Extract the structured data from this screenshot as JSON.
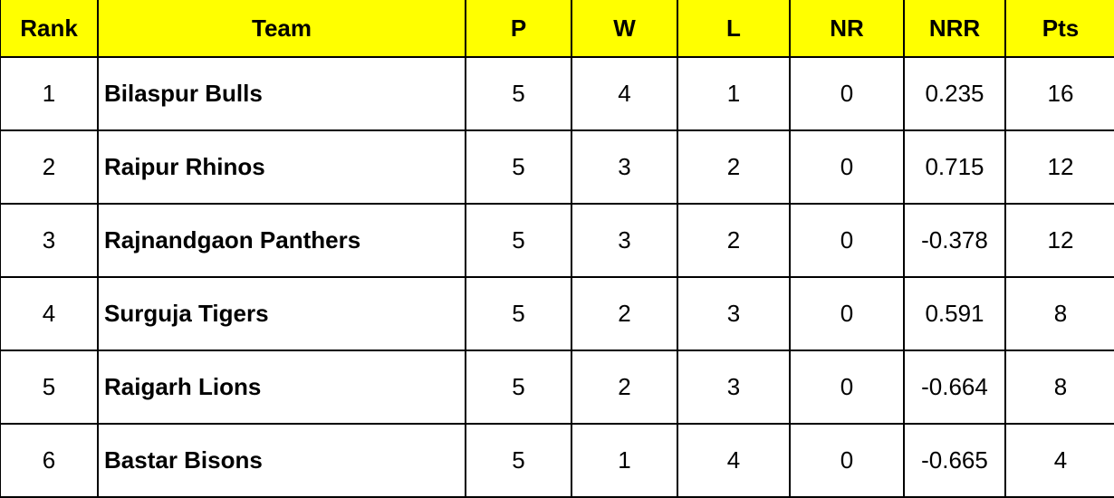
{
  "colors": {
    "header_bg": "#ffff00",
    "border": "#000000",
    "text": "#000000",
    "body_bg": "#ffffff"
  },
  "table": {
    "headers": {
      "rank": "Rank",
      "team": "Team",
      "p": "P",
      "w": "W",
      "l": "L",
      "nr": "NR",
      "nrr": "NRR",
      "pts": "Pts"
    },
    "rows": [
      {
        "rank": "1",
        "team": "Bilaspur Bulls",
        "p": "5",
        "w": "4",
        "l": "1",
        "nr": "0",
        "nrr": "0.235",
        "pts": "16"
      },
      {
        "rank": "2",
        "team": "Raipur Rhinos",
        "p": "5",
        "w": "3",
        "l": "2",
        "nr": "0",
        "nrr": "0.715",
        "pts": "12"
      },
      {
        "rank": "3",
        "team": "Rajnandgaon Panthers",
        "p": "5",
        "w": "3",
        "l": "2",
        "nr": "0",
        "nrr": "-0.378",
        "pts": "12"
      },
      {
        "rank": "4",
        "team": "Surguja Tigers",
        "p": "5",
        "w": "2",
        "l": "3",
        "nr": "0",
        "nrr": "0.591",
        "pts": "8"
      },
      {
        "rank": "5",
        "team": "Raigarh Lions",
        "p": "5",
        "w": "2",
        "l": "3",
        "nr": "0",
        "nrr": "-0.664",
        "pts": "8"
      },
      {
        "rank": "6",
        "team": "Bastar Bisons",
        "p": "5",
        "w": "1",
        "l": "4",
        "nr": "0",
        "nrr": "-0.665",
        "pts": "4"
      }
    ]
  }
}
